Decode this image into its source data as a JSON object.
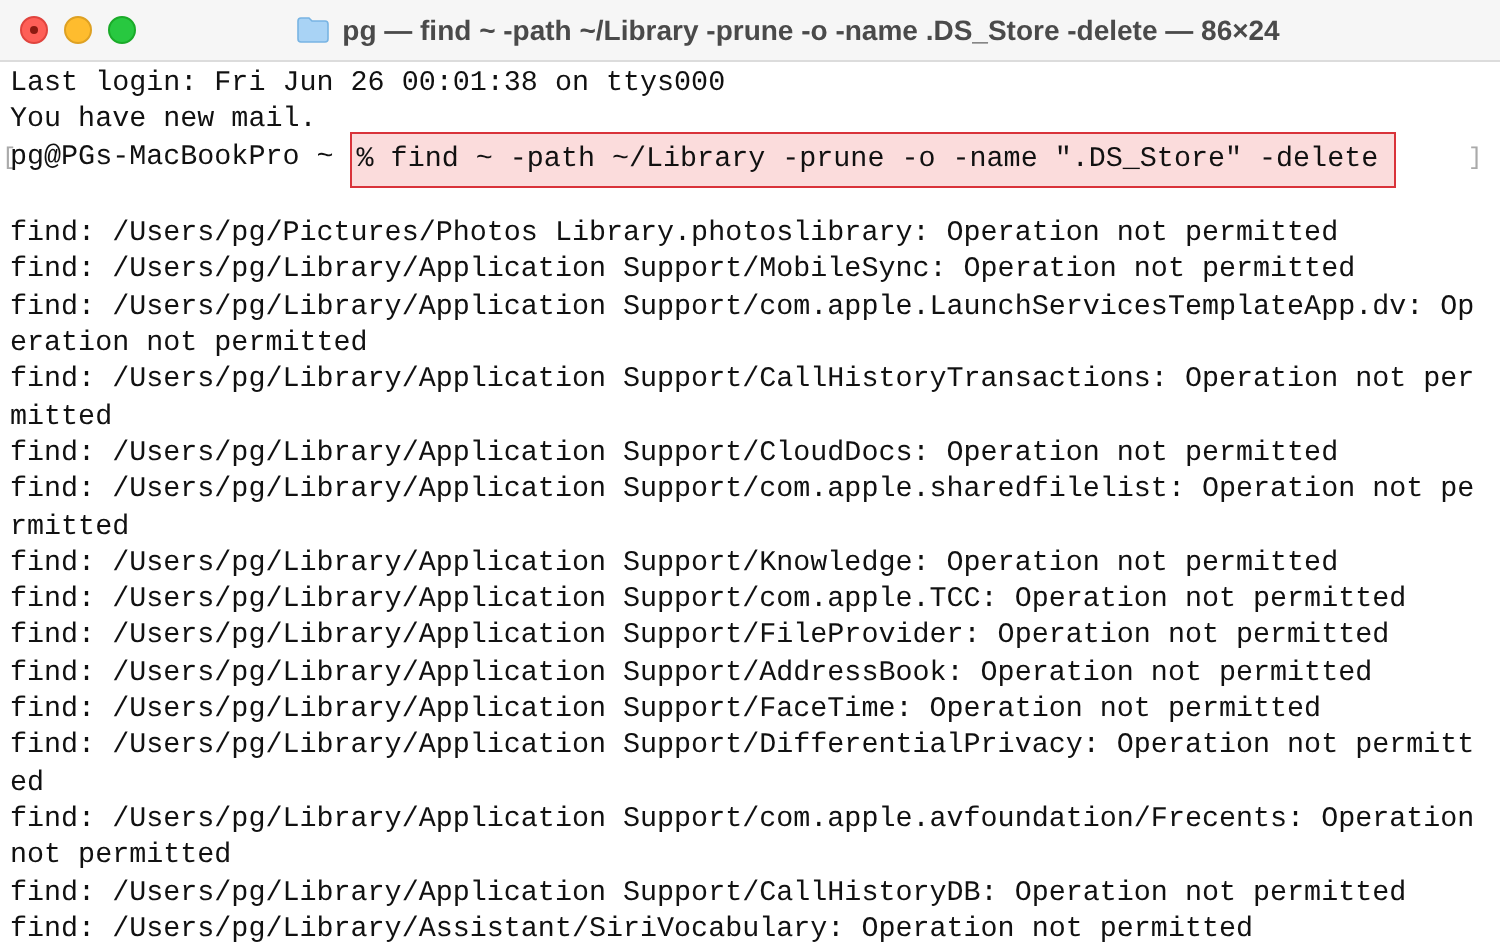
{
  "window": {
    "title": "pg — find ~ -path ~/Library -prune -o -name .DS_Store -delete — 86×24"
  },
  "terminal": {
    "lines": [
      {
        "kind": "text",
        "text": "Last login: Fri Jun 26 00:01:38 on ttys000"
      },
      {
        "kind": "text",
        "text": "You have new mail."
      },
      {
        "kind": "prompt",
        "mark_left": "[",
        "prompt": "pg@PGs-MacBookPro ~ ",
        "command": "% find ~ -path ~/Library -prune -o -name \".DS_Store\" -delete",
        "highlighted": true,
        "mark_right": "]"
      },
      {
        "kind": "blank"
      },
      {
        "kind": "text",
        "text": "find: /Users/pg/Pictures/Photos Library.photoslibrary: Operation not permitted"
      },
      {
        "kind": "text",
        "text": "find: /Users/pg/Library/Application Support/MobileSync: Operation not permitted"
      },
      {
        "kind": "text",
        "text": "find: /Users/pg/Library/Application Support/com.apple.LaunchServicesTemplateApp.dv: Operation not permitted"
      },
      {
        "kind": "text",
        "text": "find: /Users/pg/Library/Application Support/CallHistoryTransactions: Operation not permitted"
      },
      {
        "kind": "text",
        "text": "find: /Users/pg/Library/Application Support/CloudDocs: Operation not permitted"
      },
      {
        "kind": "text",
        "text": "find: /Users/pg/Library/Application Support/com.apple.sharedfilelist: Operation not permitted"
      },
      {
        "kind": "text",
        "text": "find: /Users/pg/Library/Application Support/Knowledge: Operation not permitted"
      },
      {
        "kind": "text",
        "text": "find: /Users/pg/Library/Application Support/com.apple.TCC: Operation not permitted"
      },
      {
        "kind": "text",
        "text": "find: /Users/pg/Library/Application Support/FileProvider: Operation not permitted"
      },
      {
        "kind": "text",
        "text": "find: /Users/pg/Library/Application Support/AddressBook: Operation not permitted"
      },
      {
        "kind": "text",
        "text": "find: /Users/pg/Library/Application Support/FaceTime: Operation not permitted"
      },
      {
        "kind": "text",
        "text": "find: /Users/pg/Library/Application Support/DifferentialPrivacy: Operation not permitted"
      },
      {
        "kind": "text",
        "text": "find: /Users/pg/Library/Application Support/com.apple.avfoundation/Frecents: Operation not permitted"
      },
      {
        "kind": "text",
        "text": "find: /Users/pg/Library/Application Support/CallHistoryDB: Operation not permitted"
      },
      {
        "kind": "text",
        "text": "find: /Users/pg/Library/Assistant/SiriVocabulary: Operation not permitted"
      }
    ]
  }
}
